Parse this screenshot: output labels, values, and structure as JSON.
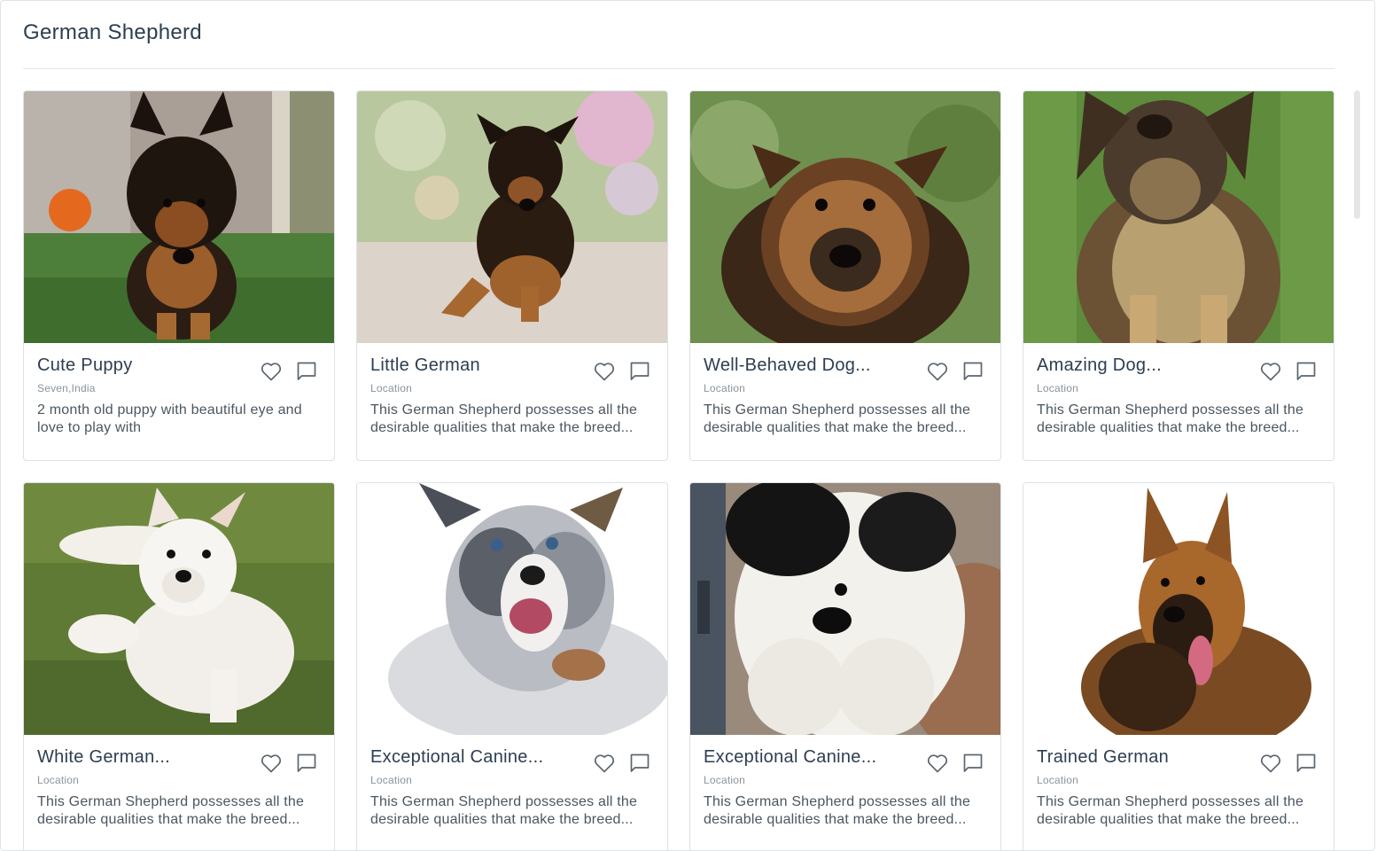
{
  "page": {
    "title": "German Shepherd"
  },
  "cards": [
    {
      "title": "Cute Puppy",
      "location": "Seven,India",
      "description": "2 month old puppy with beautiful eye and love to play with"
    },
    {
      "title": "Little German",
      "location": "Location",
      "description": "This German Shepherd possesses all the desirable qualities that make the breed..."
    },
    {
      "title": "Well-Behaved Dog...",
      "location": "Location",
      "description": "This German Shepherd possesses all the desirable qualities that make the breed..."
    },
    {
      "title": "Amazing Dog...",
      "location": "Location",
      "description": "This German Shepherd possesses all the desirable qualities that make the breed..."
    },
    {
      "title": "White German...",
      "location": "Location",
      "description": "This German Shepherd possesses all the desirable qualities that make the breed..."
    },
    {
      "title": "Exceptional Canine...",
      "location": "Location",
      "description": "This German Shepherd possesses all the desirable qualities that make the breed..."
    },
    {
      "title": "Exceptional Canine...",
      "location": "Location",
      "description": "This German Shepherd possesses all the desirable qualities that make the breed..."
    },
    {
      "title": "Trained German",
      "location": "Location",
      "description": "This German Shepherd possesses all the desirable qualities that make the breed..."
    }
  ],
  "icons": {
    "like": "heart-icon",
    "comment": "comment-icon"
  },
  "colors": {
    "title_text": "#2c3e50",
    "border": "#dde1e5",
    "muted_text": "#8a949c",
    "icon_stroke": "#5b6670"
  }
}
